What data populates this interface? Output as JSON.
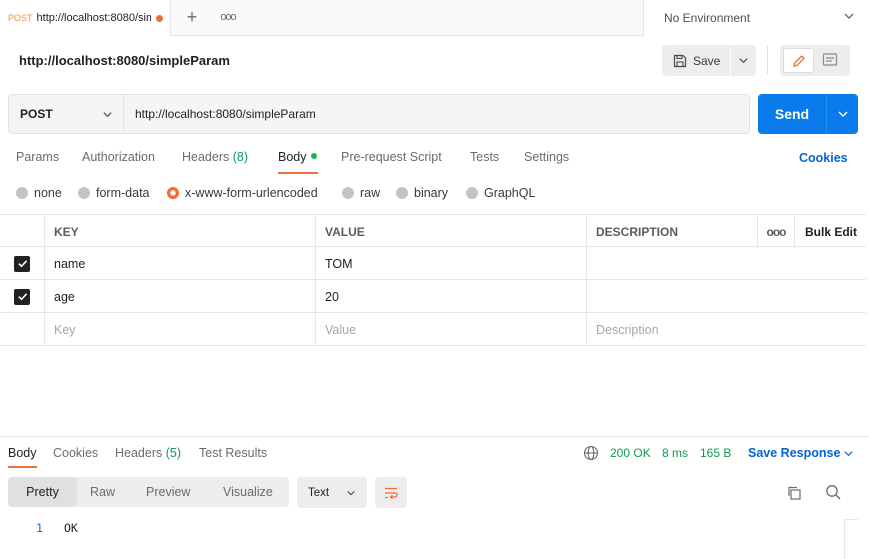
{
  "tabs": {
    "method": "POST",
    "name": "http://localhost:8080/simpleParam",
    "more": "ooo"
  },
  "environment": {
    "label": "No Environment"
  },
  "request": {
    "title": "http://localhost:8080/simpleParam",
    "save_label": "Save",
    "method": "POST",
    "url": "http://localhost:8080/simpleParam",
    "send_label": "Send"
  },
  "request_tabs": {
    "params": "Params",
    "authorization": "Authorization",
    "headers": "Headers",
    "headers_count": "(8)",
    "body": "Body",
    "prerequest": "Pre-request Script",
    "tests": "Tests",
    "settings": "Settings",
    "cookies": "Cookies"
  },
  "body_types": {
    "none": "none",
    "form_data": "form-data",
    "urlencoded": "x-www-form-urlencoded",
    "raw": "raw",
    "binary": "binary",
    "graphql": "GraphQL",
    "selected": "x-www-form-urlencoded"
  },
  "params_table": {
    "headers": {
      "key": "KEY",
      "value": "VALUE",
      "description": "DESCRIPTION",
      "more": "ooo",
      "bulk_edit": "Bulk Edit"
    },
    "rows": [
      {
        "key": "name",
        "value": "TOM",
        "description": "",
        "checked": true
      },
      {
        "key": "age",
        "value": "20",
        "description": "",
        "checked": true
      }
    ],
    "placeholder": {
      "key": "Key",
      "value": "Value",
      "description": "Description"
    }
  },
  "response": {
    "tabs": {
      "body": "Body",
      "cookies": "Cookies",
      "headers": "Headers",
      "headers_count": "(5)",
      "test_results": "Test Results"
    },
    "status": "200 OK",
    "time": "8 ms",
    "size": "165 B",
    "save_response": "Save Response",
    "formats": {
      "pretty": "Pretty",
      "raw": "Raw",
      "preview": "Preview",
      "visualize": "Visualize"
    },
    "text_type": "Text",
    "lines": [
      {
        "number": "1",
        "text": "OK"
      }
    ]
  },
  "colors": {
    "accent": "#f26b3a",
    "send": "#097bed",
    "link": "#0265d2",
    "success": "#0c9b55"
  }
}
